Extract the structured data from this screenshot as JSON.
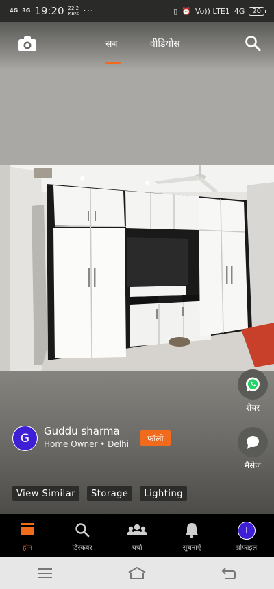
{
  "status_bar": {
    "signal_1": "4G",
    "signal_2": "3G",
    "time": "19:20",
    "speed_value": "22.2",
    "speed_unit": "KB/s",
    "more": "···",
    "volte": "Vo)) LTE1",
    "network": "4G",
    "battery": "20"
  },
  "top_nav": {
    "camera_icon": "camera-icon",
    "tab_all": "सब",
    "tab_videos": "वीडियोस",
    "active_tab": "सब",
    "search_icon": "search-icon",
    "accent_color": "#f26a1b"
  },
  "photo": {
    "subject": "white glossy wardrobe with tv unit"
  },
  "actions": {
    "share_label": "शेयर",
    "message_label": "मैसेज"
  },
  "author": {
    "initial": "G",
    "name": "Guddu sharma",
    "role": "Home Owner • Delhi",
    "follow_label": "फॉलो"
  },
  "tags": [
    "View Similar",
    "Storage",
    "Lighting"
  ],
  "bottom_nav": [
    {
      "label": "होम",
      "icon": "home-icon",
      "active": true
    },
    {
      "label": "डिस्कवर",
      "icon": "search-icon",
      "active": false
    },
    {
      "label": "चर्चा",
      "icon": "group-icon",
      "active": false
    },
    {
      "label": "सूचनाऐं",
      "icon": "bell-icon",
      "active": false
    },
    {
      "label": "प्रोफाइल",
      "icon": "profile-icon",
      "active": false
    }
  ],
  "profile_initial": "I",
  "system_nav": [
    "menu-icon",
    "home-outline-icon",
    "back-icon"
  ]
}
